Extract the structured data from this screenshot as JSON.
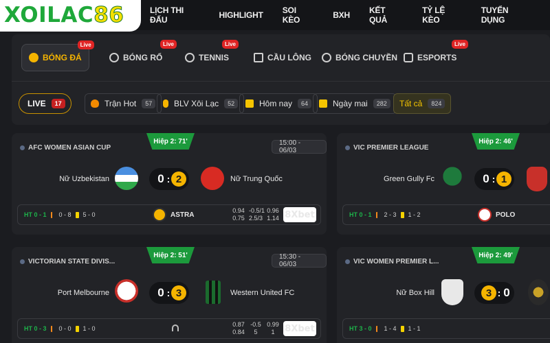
{
  "brand": {
    "logo_text": "XOILAC",
    "logo_number": "86"
  },
  "nav": [
    "LỊCH THI ĐẤU",
    "HIGHLIGHT",
    "SOI KÈO",
    "BXH",
    "KẾT QUẢ",
    "TỶ LỆ KÈO",
    "TUYỂN DỤNG"
  ],
  "sport_tabs": [
    {
      "label": "BÓNG ĐÁ",
      "icon": "soccer-ball-icon",
      "badge": "Live",
      "active": true
    },
    {
      "label": "BÓNG RỔ",
      "icon": "basketball-icon",
      "badge": "Live"
    },
    {
      "label": "TENNIS",
      "icon": "tennis-ball-icon",
      "badge": "Live"
    },
    {
      "label": "CẦU LÔNG",
      "icon": "shuttlecock-icon",
      "badge": ""
    },
    {
      "label": "BÓNG CHUYỀN",
      "icon": "volleyball-icon",
      "badge": ""
    },
    {
      "label": "ESPORTS",
      "icon": "esports-icon",
      "badge": "Live"
    }
  ],
  "filters": [
    {
      "label": "LIVE",
      "count": "17",
      "icon": "live-icon"
    },
    {
      "label": "Trận Hot",
      "count": "57",
      "icon": "fire-icon"
    },
    {
      "label": "BLV Xôi Lạc",
      "count": "52",
      "icon": "microphone-icon"
    },
    {
      "label": "Hôm nay",
      "count": "64",
      "icon": "calendar-icon"
    },
    {
      "label": "Ngày mai",
      "count": "282",
      "icon": "calendar-icon"
    },
    {
      "label": "Tất cả",
      "count": "824",
      "active": true
    }
  ],
  "matches": [
    {
      "league": "AFC WOMEN ASIAN CUP",
      "period": "Hiệp 2: 71'",
      "time": "15:00 - 06/03",
      "home": "Nữ Uzbekistan",
      "away": "Nữ Trung Quốc",
      "home_score": "0",
      "away_score": "2",
      "stats": {
        "ht": "HT 0 - 1",
        "corners": "0 - 8",
        "yellow": "5 - 0"
      },
      "sponsor": "ASTRA",
      "odds": [
        "0.94",
        "-0.5/1",
        "0.96",
        "0.75",
        "2.5/3",
        "1.14"
      ],
      "bookmaker": "8Xbet"
    },
    {
      "league": "VIC PREMIER LEAGUE",
      "period": "Hiệp 2: 46'",
      "home": "Green Gully Fc",
      "home_score": "0",
      "away_score": "1",
      "stats": {
        "ht": "HT 0 - 1",
        "corners": "2 - 3",
        "yellow": "1 - 2"
      },
      "sponsor": "POLO"
    },
    {
      "league": "VICTORIAN STATE DIVIS...",
      "period": "Hiệp 2: 51'",
      "time": "15:30 - 06/03",
      "home": "Port Melbourne",
      "away": "Western United FC",
      "home_score": "0",
      "away_score": "3",
      "stats": {
        "ht": "HT 0 - 3",
        "corners": "0 - 0",
        "yellow": "1 - 0"
      },
      "odds": [
        "0.87",
        "-0.5",
        "0.99",
        "0.84",
        "5",
        "1"
      ],
      "bookmaker": "8Xbet"
    },
    {
      "league": "VIC WOMEN PREMIER L...",
      "period": "Hiệp 2: 49'",
      "home": "Nữ Box Hill",
      "home_score": "3",
      "away_score": "0",
      "stats": {
        "ht": "HT 3 - 0",
        "corners": "1 - 4",
        "yellow": "1 - 1"
      }
    }
  ],
  "colors": {
    "accent": "#f5b400",
    "period_green": "#1c9a3c",
    "live_red": "#e02424",
    "logo_green": "#1fa83a",
    "logo_yellow": "#f6e000"
  }
}
